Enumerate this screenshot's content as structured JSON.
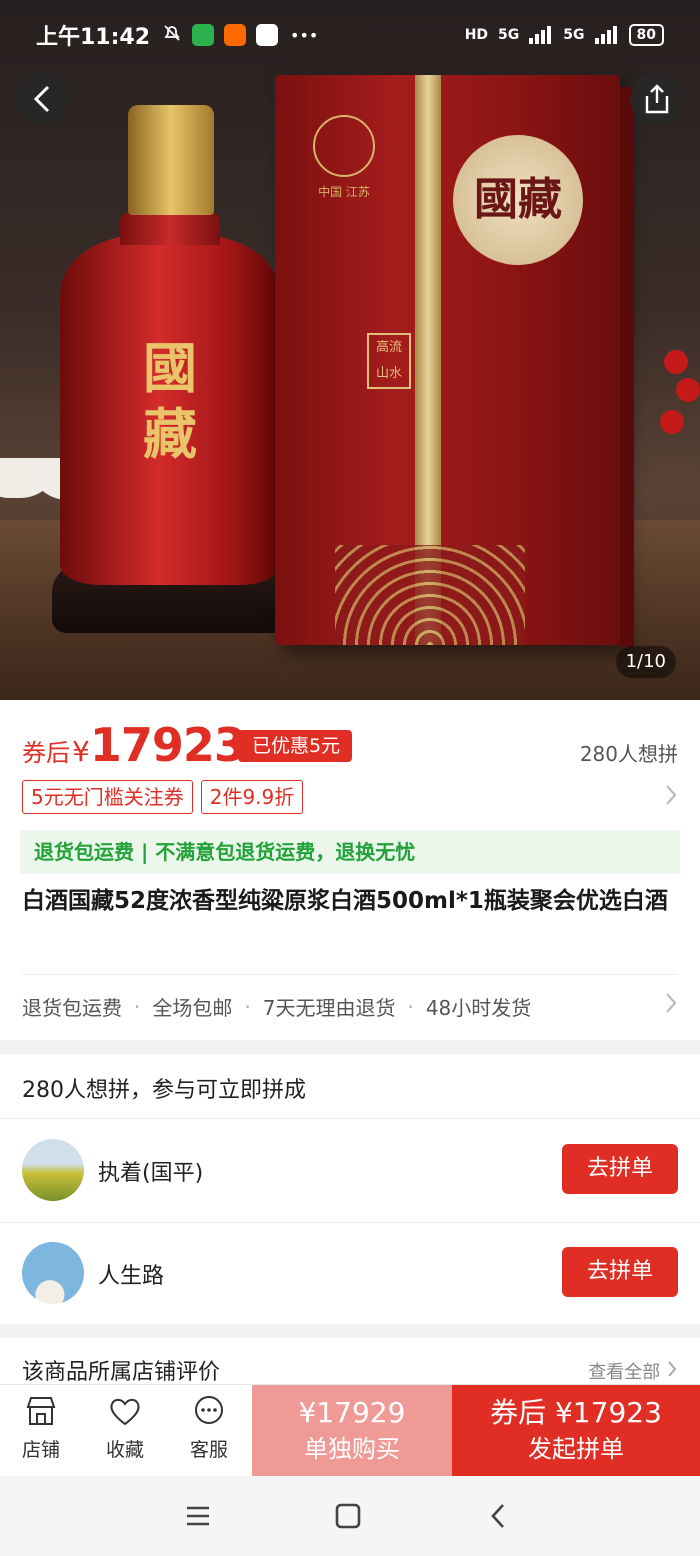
{
  "status_bar": {
    "time": "上午11:42",
    "network_left": "HD",
    "signal_1": "5G",
    "signal_2": "5G",
    "battery": "80"
  },
  "gallery": {
    "page_indicator": "1/10",
    "bottle_label": "國藏",
    "box_label": "國藏",
    "box_seal": "高流 山水",
    "box_emblem_text": "中国 江苏"
  },
  "product": {
    "price_prefix": "券后",
    "currency": "¥",
    "price": "17923",
    "discount_tag": "已优惠5元",
    "want_count": "280人想拼",
    "coupons": [
      "5元无门槛关注券",
      "2件9.9折"
    ],
    "return_banner": "退货包运费 | 不满意包退货运费，退换无忧",
    "title": "白酒国藏52度浓香型纯粱原浆白酒500ml*1瓶装聚会优选白酒",
    "services": [
      "退货包运费",
      "全场包邮",
      "7天无理由退货",
      "48小时发货"
    ],
    "service_separator": "·"
  },
  "group_buy": {
    "heading": "280人想拼，参与可立即拼成",
    "rows": [
      {
        "name": "执着(国平)",
        "button": "去拼单"
      },
      {
        "name": "人生路",
        "button": "去拼单"
      }
    ]
  },
  "reviews": {
    "title": "该商品所属店铺评价",
    "view_all": "查看全部"
  },
  "action_bar": {
    "store": "店铺",
    "favorite": "收藏",
    "service": "客服",
    "solo_price": "¥17929",
    "solo_label": "单独购买",
    "group_price": "券后 ¥17923",
    "group_label": "发起拼单"
  },
  "colors": {
    "accent": "#e02e24",
    "solo_button": "#ef9a96",
    "banner_green": "#23a23a"
  }
}
